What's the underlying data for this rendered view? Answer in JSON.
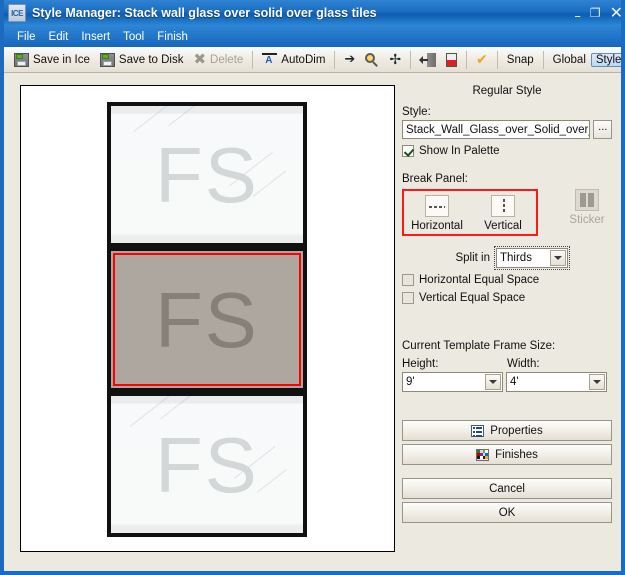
{
  "window": {
    "app_icon_text": "ICE",
    "title": "Style Manager: Stack wall glass over solid  over glass tiles",
    "minimize_label": "–",
    "maximize_label": "❐",
    "close_label": "✕"
  },
  "menubar": {
    "items": [
      {
        "label": "File"
      },
      {
        "label": "Edit"
      },
      {
        "label": "Insert"
      },
      {
        "label": "Tool"
      },
      {
        "label": "Finish"
      }
    ]
  },
  "toolbar": {
    "save_in_ice": "Save in Ice",
    "save_to_disk": "Save to Disk",
    "delete": "Delete",
    "autodim": "AutoDim",
    "snap": "Snap",
    "global": "Global",
    "style": "Style"
  },
  "canvas": {
    "panels": [
      {
        "label": "FS",
        "kind": "glass",
        "selected": false
      },
      {
        "label": "FS",
        "kind": "solid",
        "selected": true
      },
      {
        "label": "FS",
        "kind": "glass",
        "selected": false
      }
    ]
  },
  "side": {
    "heading": "Regular Style",
    "style_label": "Style:",
    "style_value": "Stack_Wall_Glass_over_Solid_over_G",
    "browse_label": "...",
    "show_in_palette": "Show In Palette",
    "show_in_palette_checked": true,
    "break_panel_label": "Break Panel:",
    "break_horizontal": "Horizontal",
    "break_vertical": "Vertical",
    "break_sticker": "Sticker",
    "split_in_label": "Split in",
    "split_in_value": "Thirds",
    "horizontal_equal_space": "Horizontal Equal Space",
    "vertical_equal_space": "Vertical Equal Space",
    "frame_size_label": "Current Template Frame Size:",
    "height_label": "Height:",
    "height_value": "9'",
    "width_label": "Width:",
    "width_value": "4'",
    "properties": "Properties",
    "finishes": "Finishes",
    "cancel": "Cancel",
    "ok": "OK"
  },
  "colors": {
    "title_bar": "#1a6cc0",
    "window_frame": "#1d6bbf",
    "panel_background": "#ece9e0",
    "selection_red": "#ff0000",
    "highlight_box_red": "#ff1a1a",
    "solid_panel_fill": "#aea79f",
    "glass_panel_fill": "#f7f9fa",
    "fs_text_glass": "#d4d7d8",
    "fs_text_solid": "#887f77"
  }
}
